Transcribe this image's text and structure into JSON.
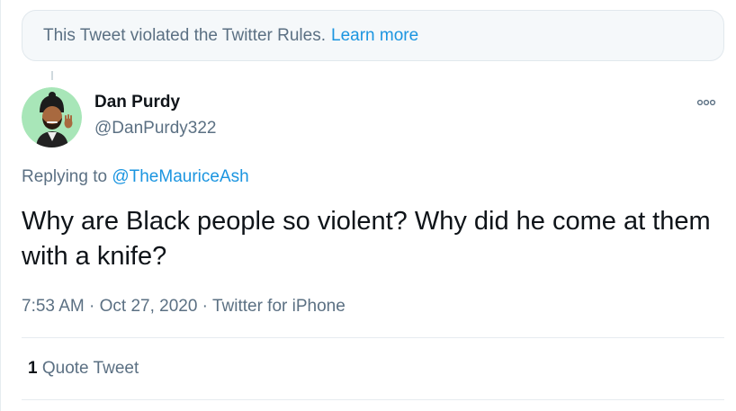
{
  "notice": {
    "text": "This Tweet violated the Twitter Rules.",
    "link": "Learn more"
  },
  "user": {
    "name": "Dan Purdy",
    "handle": "@DanPurdy322",
    "avatar_icon": "memoji-avatar"
  },
  "reply": {
    "prefix": "Replying to",
    "mention": "@TheMauriceAsh"
  },
  "tweet": {
    "text": "Why are Black people so violent? Why did he come at them with a knife?"
  },
  "meta": {
    "time": "7:53 AM",
    "separator1": " · ",
    "date": "Oct 27, 2020",
    "separator2": " · ",
    "source": "Twitter for iPhone"
  },
  "stats": {
    "quote_count": "1",
    "quote_label": "Quote Tweet"
  },
  "colors": {
    "link": "#1b95e0",
    "secondary_text": "#5b7083",
    "notice_bg": "#f5f8fa",
    "avatar_bg": "#a8e6b8"
  }
}
